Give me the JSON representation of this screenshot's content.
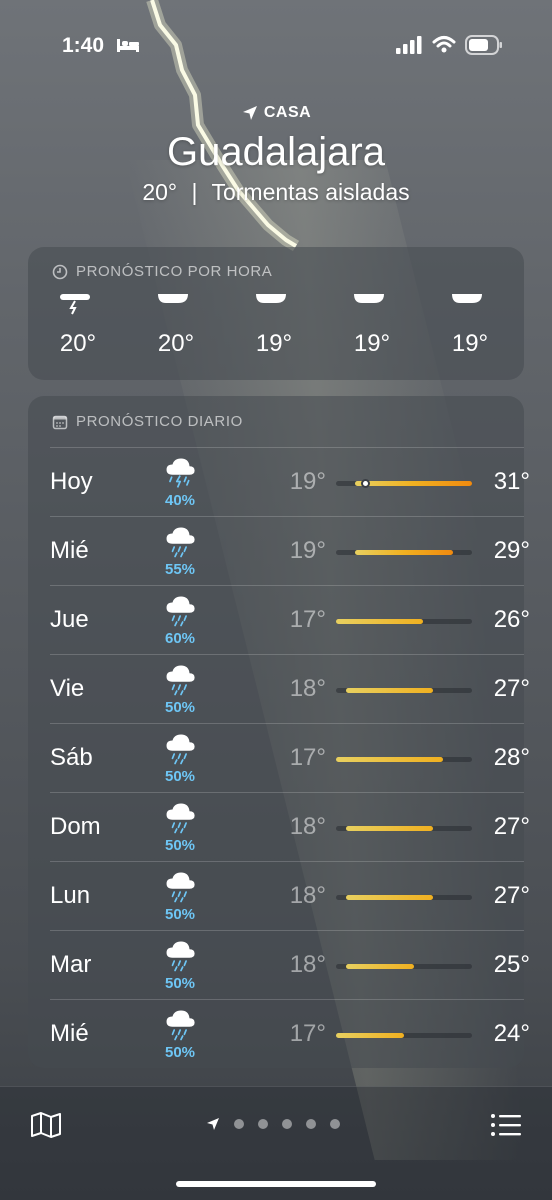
{
  "status_bar": {
    "time": "1:40"
  },
  "location": {
    "label": "CASA",
    "city": "Guadalajara",
    "current_temp": "20°",
    "separator": "|",
    "condition": "Tormentas aisladas"
  },
  "hourly": {
    "title": "PRONÓSTICO POR HORA",
    "items": [
      {
        "icon": "thunderstorm-icon",
        "temp": "20°"
      },
      {
        "icon": "cloud-icon",
        "temp": "20°"
      },
      {
        "icon": "cloud-icon",
        "temp": "19°"
      },
      {
        "icon": "cloud-icon",
        "temp": "19°"
      },
      {
        "icon": "cloud-icon",
        "temp": "19°"
      }
    ]
  },
  "daily": {
    "title": "PRONÓSTICO DIARIO",
    "days": [
      {
        "day": "Hoy",
        "icon": "thunderstorm-icon",
        "pop": "40%",
        "low": "19°",
        "high": "31°",
        "current": "20°"
      },
      {
        "day": "Mié",
        "icon": "rain-icon",
        "pop": "55%",
        "low": "19°",
        "high": "29°"
      },
      {
        "day": "Jue",
        "icon": "rain-icon",
        "pop": "60%",
        "low": "17°",
        "high": "26°"
      },
      {
        "day": "Vie",
        "icon": "rain-icon",
        "pop": "50%",
        "low": "18°",
        "high": "27°"
      },
      {
        "day": "Sáb",
        "icon": "rain-icon",
        "pop": "50%",
        "low": "17°",
        "high": "28°"
      },
      {
        "day": "Dom",
        "icon": "rain-icon",
        "pop": "50%",
        "low": "18°",
        "high": "27°"
      },
      {
        "day": "Lun",
        "icon": "rain-icon",
        "pop": "50%",
        "low": "18°",
        "high": "27°"
      },
      {
        "day": "Mar",
        "icon": "rain-icon",
        "pop": "50%",
        "low": "18°",
        "high": "25°"
      },
      {
        "day": "Mié",
        "icon": "rain-icon",
        "pop": "50%",
        "low": "17°",
        "high": "24°"
      }
    ],
    "range_min": 17,
    "range_max": 31
  },
  "bottom_bar": {
    "map": "map-icon",
    "list": "list-icon",
    "pages": 5,
    "active_page": 0
  },
  "colors": {
    "pop": "#6ec6f5",
    "warm": "#f0b020",
    "hot": "#f08a10",
    "mild": "#e8d060"
  }
}
